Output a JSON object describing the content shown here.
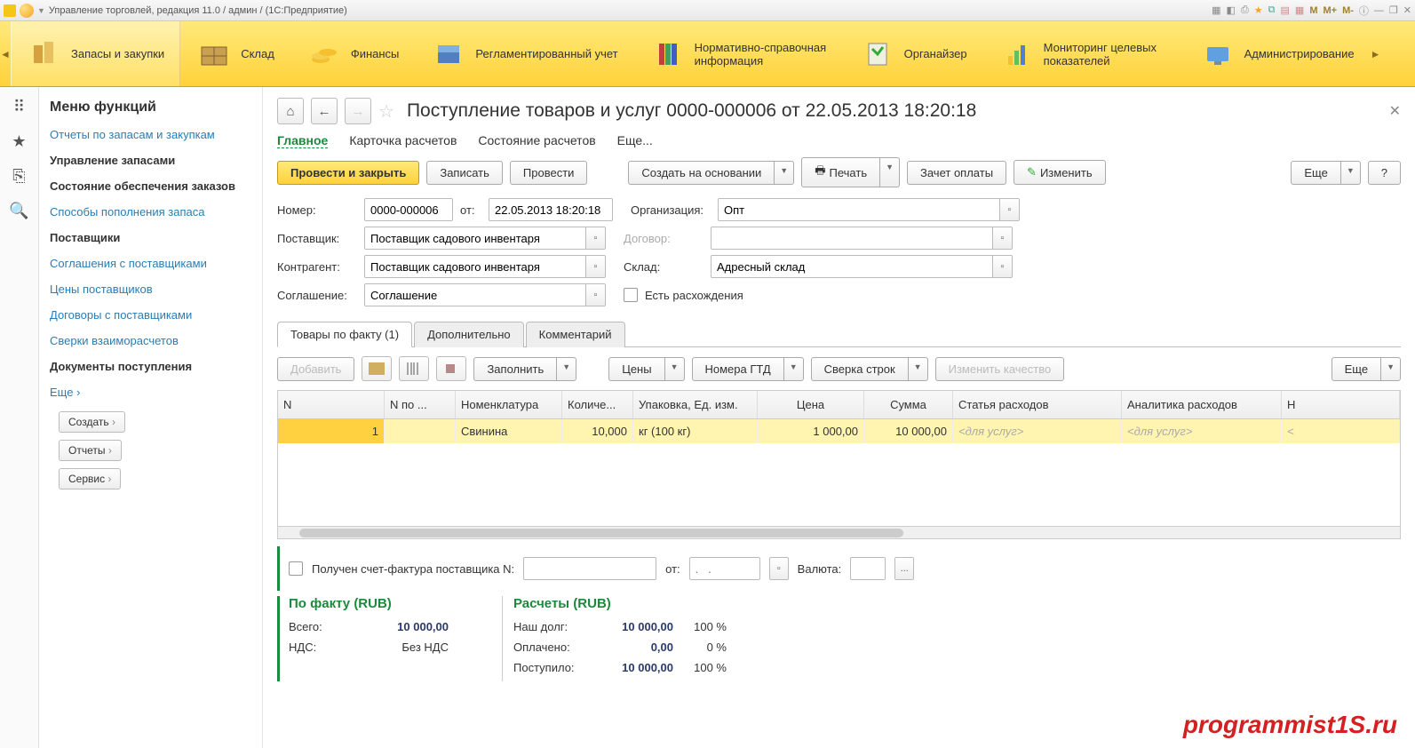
{
  "titlebar": {
    "text": "Управление торговлей, редакция 11.0 / админ /   (1С:Предприятие)",
    "m": "M",
    "mp": "M+",
    "mm": "M-"
  },
  "ribbon": {
    "items": [
      {
        "label": "Запасы и закупки"
      },
      {
        "label": "Склад"
      },
      {
        "label": "Финансы"
      },
      {
        "label": "Регламентированный учет"
      },
      {
        "label": "Нормативно-справочная информация"
      },
      {
        "label": "Органайзер"
      },
      {
        "label": "Мониторинг целевых показателей"
      },
      {
        "label": "Администрирование"
      }
    ]
  },
  "sidebar": {
    "title": "Меню функций",
    "items": [
      "Отчеты по запасам и закупкам",
      "Управление запасами",
      "Состояние обеспечения заказов",
      "Способы пополнения запаса",
      "Поставщики",
      "Соглашения с поставщиками",
      "Цены поставщиков",
      "Договоры с поставщиками",
      "Сверки взаиморасчетов",
      "Документы поступления",
      "Еще ›"
    ],
    "buttons": [
      "Создать",
      "Отчеты",
      "Сервис"
    ]
  },
  "doc": {
    "title": "Поступление товаров и услуг 0000-000006 от 22.05.2013 18:20:18",
    "inner_tabs": [
      "Главное",
      "Карточка расчетов",
      "Состояние расчетов",
      "Еще..."
    ],
    "actions": {
      "post_close": "Провести и закрыть",
      "write": "Записать",
      "post": "Провести",
      "create_based": "Создать на основании",
      "print": "Печать",
      "offset": "Зачет оплаты",
      "edit": "Изменить",
      "more": "Еще",
      "help": "?"
    },
    "fields": {
      "number_lbl": "Номер:",
      "number": "0000-000006",
      "from_lbl": "от:",
      "date": "22.05.2013 18:20:18",
      "org_lbl": "Организация:",
      "org": "Опт",
      "supplier_lbl": "Поставщик:",
      "supplier": "Поставщик садового инвентаря",
      "contract_lbl": "Договор:",
      "contract": "",
      "counter_lbl": "Контрагент:",
      "counter": "Поставщик садового инвентаря",
      "warehouse_lbl": "Склад:",
      "warehouse": "Адресный склад",
      "agreement_lbl": "Соглашение:",
      "agreement": "Соглашение",
      "discrep_lbl": "Есть расхождения"
    },
    "tabs": [
      "Товары по факту (1)",
      "Дополнительно",
      "Комментарий"
    ],
    "table_toolbar": {
      "add": "Добавить",
      "fill": "Заполнить",
      "prices": "Цены",
      "gtd": "Номера ГТД",
      "reconcile": "Сверка строк",
      "quality": "Изменить качество",
      "more": "Еще"
    },
    "columns": [
      "N",
      "N по ...",
      "Номенклатура",
      "Количе...",
      "Упаковка, Ед. изм.",
      "Цена",
      "Сумма",
      "Статья расходов",
      "Аналитика расходов",
      "Н"
    ],
    "row": {
      "n": "1",
      "npo": "",
      "nom": "Свинина",
      "qty": "10,000",
      "unit": "кг (100 кг)",
      "price": "1 000,00",
      "sum": "10 000,00",
      "expense": "<для услуг>",
      "analytics": "<для услуг>"
    },
    "invoice": {
      "checkbox_lbl": "Получен счет-фактура поставщика N:",
      "from_lbl": "от:",
      "date_ph": ".   .",
      "currency_lbl": "Валюта:"
    },
    "totals": {
      "fact_title": "По факту (RUB)",
      "calc_title": "Расчеты (RUB)",
      "total_lbl": "Всего:",
      "total_val": "10 000,00",
      "vat_lbl": "НДС:",
      "vat_val": "Без НДС",
      "debt_lbl": "Наш долг:",
      "debt_val": "10 000,00",
      "debt_pct": "100 %",
      "paid_lbl": "Оплачено:",
      "paid_val": "0,00",
      "paid_pct": "0 %",
      "received_lbl": "Поступило:",
      "received_val": "10 000,00",
      "received_pct": "100 %"
    }
  },
  "watermark": "programmist1S.ru"
}
